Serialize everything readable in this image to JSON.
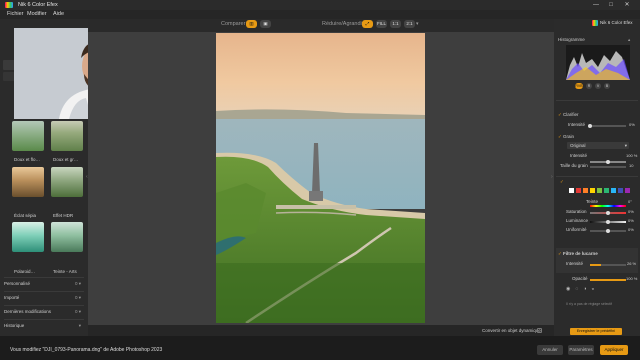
{
  "window": {
    "title": "Nik 6 Color Efex",
    "controls": [
      "—",
      "□",
      "✕"
    ]
  },
  "menu": [
    "Fichier",
    "Modifier",
    "Aide"
  ],
  "toolbar": {
    "compare_label": "Comparer",
    "resize_label": "Réduire/Agrandir",
    "zoom_options": [
      "FILL",
      "1:1",
      "2:1"
    ]
  },
  "left_panel": {
    "presets": [
      {
        "label": "Doux et flo…"
      },
      {
        "label": "Doux et gr…"
      },
      {
        "label": "Éclat sépia"
      },
      {
        "label": "Effet HDR"
      },
      {
        "label": "Polaroid…"
      },
      {
        "label": "Teinte - Arts"
      }
    ],
    "sections": [
      "Personnalisé",
      "Importé",
      "Dernières modifications",
      "Historique"
    ],
    "counts": [
      "0",
      "0",
      "0"
    ]
  },
  "right_panel": {
    "brand": "Nik 6 Color Efex",
    "histogram_label": "Histogramme",
    "channels": [
      "RVB",
      "R",
      "V",
      "B"
    ],
    "filters": [
      {
        "name": "Clarifier",
        "param_label": "Intensité",
        "value": "0%"
      },
      {
        "name": "Grain",
        "dropdown": "Original",
        "param_label": "Intensité",
        "value": "100 %",
        "param2_label": "Taille du grain",
        "value2": "10"
      }
    ],
    "color_section": {
      "params": [
        {
          "label": "Teinte",
          "value": "0°"
        },
        {
          "label": "Saturation",
          "value": "0%"
        },
        {
          "label": "Luminance",
          "value": "0%"
        },
        {
          "label": "Uniformité",
          "value": "0%"
        }
      ],
      "swatch_colors": [
        "#ffffff",
        "#e53935",
        "#ff7f27",
        "#ffd400",
        "#7cc242",
        "#2bb673",
        "#29b6f6",
        "#3f51b5",
        "#9c27b0",
        "#e91e63"
      ]
    },
    "vignette": {
      "name": "Filtre de lucarne",
      "param1_label": "Intensité",
      "param1_value": "26 %",
      "param2_label": "Opacité",
      "param2_value": "100 %"
    },
    "empty_note": "Il n'y a pas de réglage sélectif",
    "save_button": "Enregistrer le prédéfini"
  },
  "canvas": {
    "convert_label": "Convertir en objet dynamique"
  },
  "status": {
    "text": "Vous modifiez \"DJI_0793-Panorama.dng\" de Adobe Photoshop 2023"
  },
  "footer_buttons": [
    "Annuler",
    "Paramètres",
    "Appliquer"
  ],
  "colors": {
    "accent": "#e79a14",
    "panel": "#2b2b2b",
    "canvas_bg": "#3e3e3e"
  }
}
